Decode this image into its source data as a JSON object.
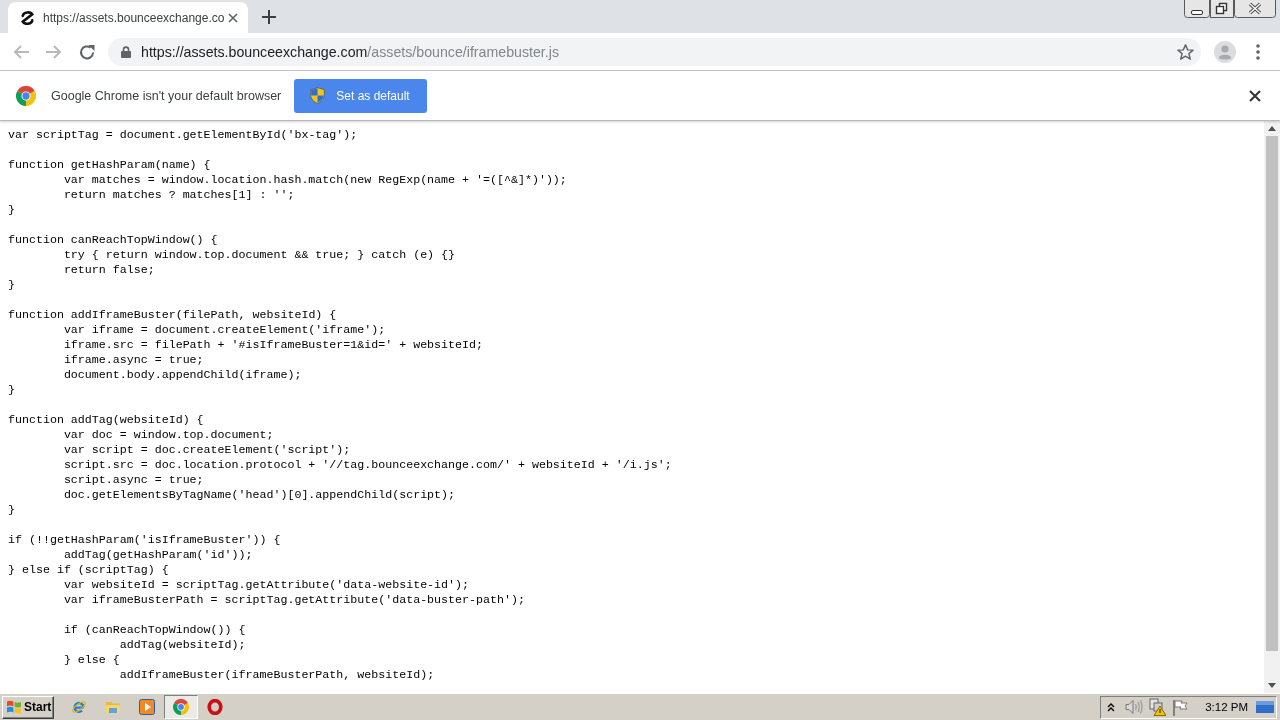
{
  "window": {
    "tabs": [
      {
        "title": "https://assets.bounceexchange.co",
        "selected": true
      }
    ]
  },
  "toolbar": {
    "back": {
      "disabled": true
    },
    "forward": {
      "disabled": true
    },
    "url": {
      "host": "https://assets.bounceexchange.com",
      "path": "/assets/bounce/iframebuster.js"
    }
  },
  "infobar": {
    "message": "Google Chrome isn't your default browser",
    "button": "Set as default"
  },
  "code": "var scriptTag = document.getElementById('bx-tag');\n\nfunction getHashParam(name) {\n\tvar matches = window.location.hash.match(new RegExp(name + '=([^&]*)'));\n\treturn matches ? matches[1] : '';\n}\n\nfunction canReachTopWindow() {\n\ttry { return window.top.document && true; } catch (e) {}\n\treturn false;\n}\n\nfunction addIframeBuster(filePath, websiteId) {\n\tvar iframe = document.createElement('iframe');\n\tiframe.src = filePath + '#isIframeBuster=1&id=' + websiteId;\n\tiframe.async = true;\n\tdocument.body.appendChild(iframe);\n}\n\nfunction addTag(websiteId) {\n\tvar doc = window.top.document;\n\tvar script = doc.createElement('script');\n\tscript.src = doc.location.protocol + '//tag.bounceexchange.com/' + websiteId + '/i.js';\n\tscript.async = true;\n\tdoc.getElementsByTagName('head')[0].appendChild(script);\n}\n\nif (!!getHashParam('isIframeBuster')) {\n\taddTag(getHashParam('id'));\n} else if (scriptTag) {\n\tvar websiteId = scriptTag.getAttribute('data-website-id');\n\tvar iframeBusterPath = scriptTag.getAttribute('data-buster-path');\n\n\tif (canReachTopWindow()) {\n\t\taddTag(websiteId);\n\t} else {\n\t\taddIframeBuster(iframeBusterPath, websiteId);",
  "taskbar": {
    "start": "Start",
    "apps": [
      {
        "kind": "ie",
        "selected": false
      },
      {
        "kind": "explorer",
        "selected": false
      },
      {
        "kind": "media",
        "selected": false
      },
      {
        "kind": "chrome",
        "selected": true
      },
      {
        "kind": "opera",
        "selected": false
      }
    ],
    "clock": "3:12 PM"
  }
}
